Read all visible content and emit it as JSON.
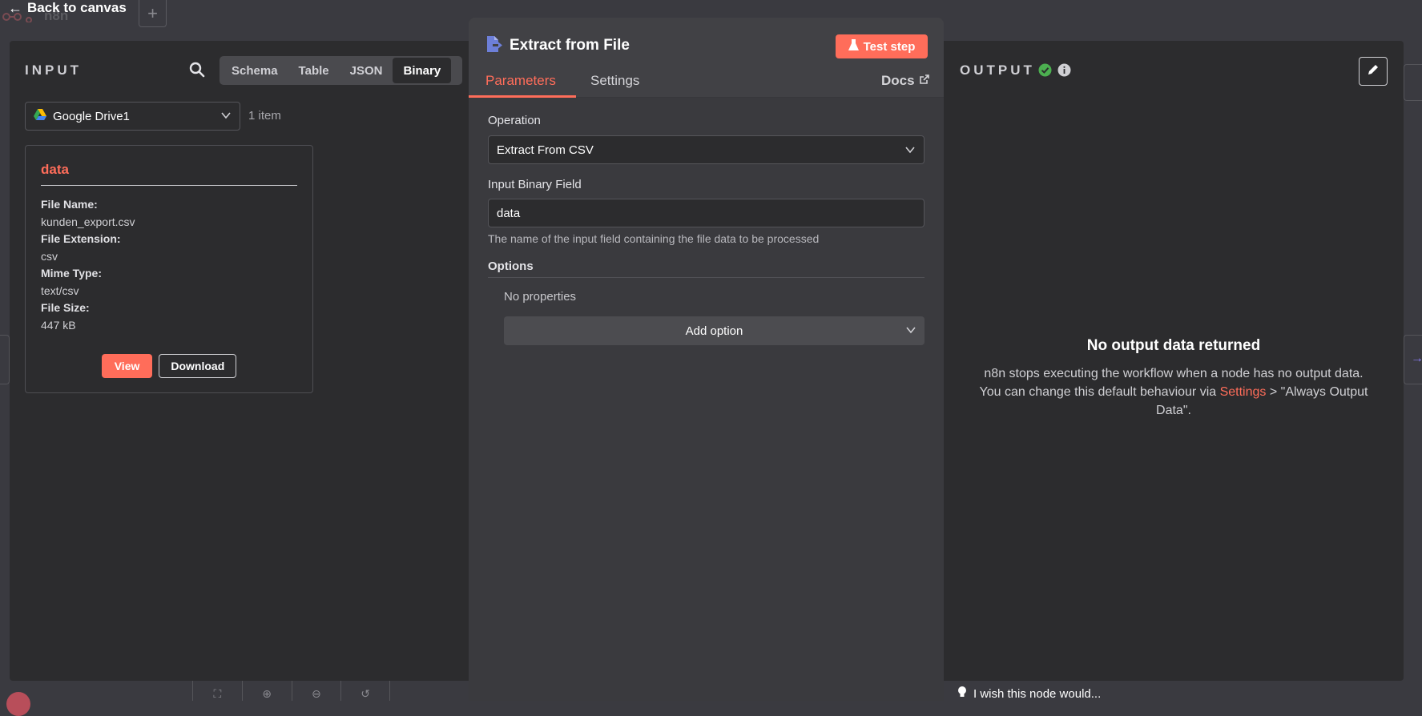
{
  "topbar": {
    "back_label": "Back to canvas",
    "app_name": "n8n",
    "add_label": "+"
  },
  "input": {
    "section_title": "INPUT",
    "view_tabs": [
      {
        "label": "Schema",
        "active": false
      },
      {
        "label": "Table",
        "active": false
      },
      {
        "label": "JSON",
        "active": false
      },
      {
        "label": "Binary",
        "active": true
      }
    ],
    "node_select": {
      "value": "Google Drive1"
    },
    "item_count": "1 item",
    "binary": {
      "title": "data",
      "props": [
        {
          "label": "File Name:",
          "value": "kunden_export.csv"
        },
        {
          "label": "File Extension:",
          "value": "csv"
        },
        {
          "label": "Mime Type:",
          "value": "text/csv"
        },
        {
          "label": "File Size:",
          "value": "447 kB"
        }
      ],
      "view_label": "View",
      "download_label": "Download"
    }
  },
  "node": {
    "title": "Extract from File",
    "test_label": "Test step",
    "tabs": [
      {
        "label": "Parameters",
        "active": true
      },
      {
        "label": "Settings",
        "active": false
      }
    ],
    "docs_label": "Docs",
    "operation": {
      "label": "Operation",
      "value": "Extract From CSV"
    },
    "binary_field": {
      "label": "Input Binary Field",
      "value": "data",
      "hint": "The name of the input field containing the file data to be processed"
    },
    "options": {
      "label": "Options",
      "empty": "No properties",
      "add_label": "Add option"
    }
  },
  "output": {
    "section_title": "OUTPUT",
    "empty_title": "No output data returned",
    "empty_text_1": "n8n stops executing the workflow when a node has no output data. You can change this default behaviour via",
    "empty_link": "Settings",
    "empty_text_2": "> \"Always Output Data\"."
  },
  "footer": {
    "wish_label": "I wish this node would..."
  },
  "colors": {
    "accent": "#ff6d5a",
    "success": "#4caf50",
    "panel": "#2c2c2e"
  },
  "icons": [
    "back-arrow-icon",
    "search-icon",
    "google-drive-icon",
    "chevron-down-icon",
    "file-extract-icon",
    "flask-icon",
    "external-link-icon",
    "pencil-icon",
    "check-circle-icon",
    "info-icon",
    "lightbulb-icon"
  ]
}
